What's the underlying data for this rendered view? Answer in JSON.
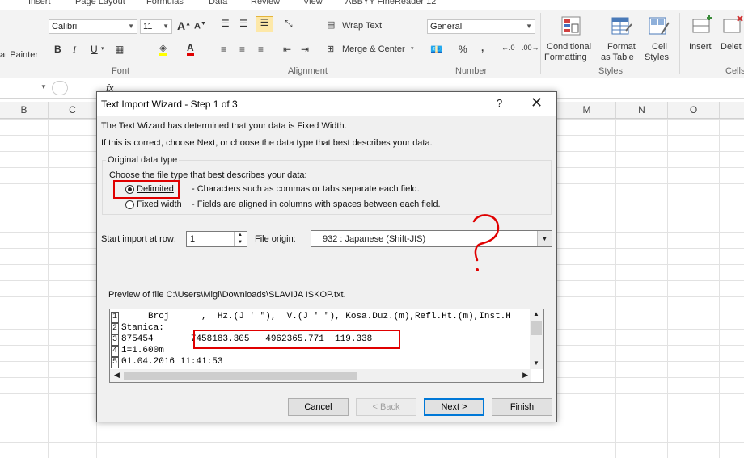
{
  "ribbon_tabs": [
    "Insert",
    "Page Layout",
    "Formulas",
    "Data",
    "Review",
    "View",
    "ABBYY FineReader 12"
  ],
  "ribbon": {
    "clipboard_label": "at Painter",
    "font_name": "Calibri",
    "font_size": "11",
    "font_group": "Font",
    "wrap_text": "Wrap Text",
    "merge_center": "Merge & Center",
    "alignment_group": "Alignment",
    "number_format": "General",
    "percent": "%",
    "comma": ",",
    "number_group": "Number",
    "conditional_formatting_1": "Conditional",
    "conditional_formatting_2": "Formatting",
    "format_as_table_1": "Format",
    "format_as_table_2": "as Table",
    "cell_styles_1": "Cell",
    "cell_styles_2": "Styles",
    "styles_group": "Styles",
    "insert": "Insert",
    "delete": "Delet",
    "cells_group": "Cells",
    "fx": "fx"
  },
  "columns": [
    "B",
    "C",
    "M",
    "N",
    "O"
  ],
  "dialog": {
    "title": "Text Import Wizard - Step 1 of 3",
    "help": "?",
    "close": "✕",
    "intro_1": "The Text Wizard has determined that your data is Fixed Width.",
    "intro_2": "If this is correct, choose Next, or choose the data type that best describes your data.",
    "group_title": "Original data type",
    "choose_label": "Choose the file type that best describes your data:",
    "radio_delimited": "Delimited",
    "desc_delimited": "- Characters such as commas or tabs separate each field.",
    "radio_fixed": "Fixed width",
    "desc_fixed": "- Fields are aligned in columns with spaces between each field.",
    "start_row_label": "Start import at row:",
    "start_row_value": "1",
    "file_origin_label": "File origin:",
    "file_origin_value": "932 : Japanese (Shift-JIS)",
    "preview_label": "Preview of file C:\\Users\\Migi\\Downloads\\SLAVIJA ISKOP.txt.",
    "preview_lines": [
      {
        "num": "1",
        "text": "     Broj      ,  Hz.(J ' \"),  V.(J ' \"), Kosa.Duz.(m),Refl.Ht.(m),Inst.H"
      },
      {
        "num": "2",
        "text": "Stanica:"
      },
      {
        "num": "3",
        "text": "875454       7458183.305   4962365.771  119.338"
      },
      {
        "num": "4",
        "text": "i=1.600m"
      },
      {
        "num": "5",
        "text": "01.04.2016 11:41:53"
      }
    ],
    "buttons": {
      "cancel": "Cancel",
      "back": "< Back",
      "next": "Next >",
      "finish": "Finish"
    }
  }
}
